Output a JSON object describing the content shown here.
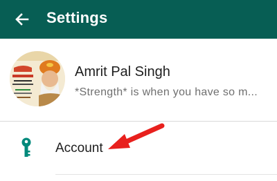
{
  "header": {
    "title": "Settings",
    "back_icon": "arrow-left-icon",
    "background_color": "#075e54"
  },
  "profile": {
    "name": "Amrit Pal Singh",
    "status": "*Strength* is when you have so m..."
  },
  "menu": {
    "account": {
      "label": "Account",
      "icon": "key-icon",
      "icon_color": "#00897b"
    }
  },
  "annotation": {
    "arrow_color": "#e8201d"
  }
}
